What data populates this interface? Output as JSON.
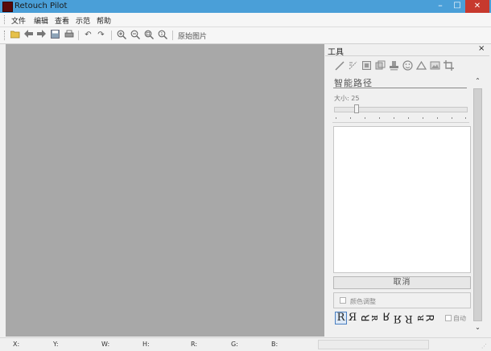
{
  "window": {
    "title": "Retouch Pilot",
    "minimize": "–",
    "maximize": "□",
    "close": "✕"
  },
  "menu": [
    "文件",
    "编辑",
    "查看",
    "示范",
    "帮助"
  ],
  "toolbar": {
    "original_image_label": "原始图片"
  },
  "tool_panel": {
    "title": "工具",
    "close": "×",
    "current_tool": "智能路径",
    "size_label": "大小: 25",
    "size_value": 25,
    "cancel_label": "取消",
    "color_adjust_label": "颜色调整",
    "auto_label": "自动",
    "r_glyphs": [
      "R",
      "Я",
      "ꓤ",
      "ᴚ",
      "ꓤ",
      "Я",
      "R",
      "ᴚ",
      "ꓤ"
    ]
  },
  "status": {
    "x": "X:",
    "y": "Y:",
    "w": "W:",
    "h": "H:",
    "r": "R:",
    "g": "G:",
    "b": "B:"
  },
  "colors": {
    "title_bar": "#4a9fd8",
    "close_button": "#c7392e",
    "canvas_bg": "#a8a8a8"
  }
}
